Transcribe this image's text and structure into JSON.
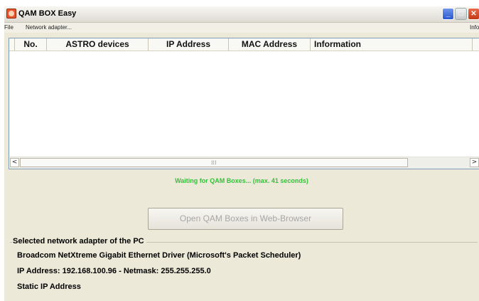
{
  "window": {
    "title": "QAM BOX Easy",
    "controls": {
      "minimize": "_",
      "maximize": "□",
      "close": "✕"
    }
  },
  "menu": {
    "file": "File",
    "network_adapter": "Network adapter...",
    "info": "Info"
  },
  "list": {
    "columns": [
      "No.",
      "ASTRO devices",
      "IP Address",
      "MAC Address",
      "Information"
    ],
    "rows": []
  },
  "scrollbar": {
    "left_arrow": "<",
    "right_arrow": ">",
    "grip": "⁞⁞⁞"
  },
  "status": {
    "text": "Waiting for QAM Boxes...  (max. 41 seconds)",
    "color": "#33c13a"
  },
  "open_button": {
    "label": "Open QAM Boxes in Web-Browser",
    "enabled": false
  },
  "adapter": {
    "legend": "Selected network adapter of the PC",
    "driver": "Broadcom NetXtreme Gigabit Ethernet Driver (Microsoft's Packet Scheduler)",
    "ip_line": "IP Address: 192.168.100.96  -  Netmask: 255.255.255.0",
    "mode": "Static IP Address"
  }
}
